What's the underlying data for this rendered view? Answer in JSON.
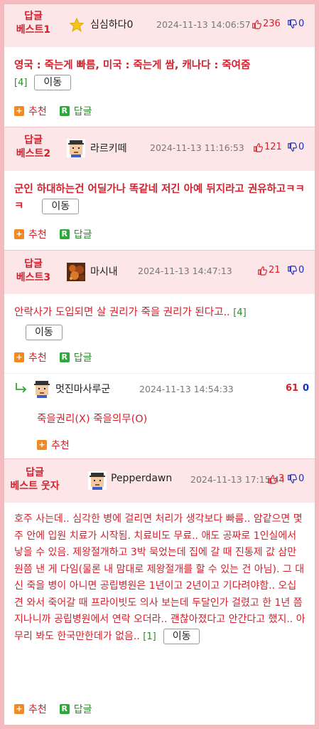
{
  "comments": [
    {
      "badge_line1": "답글",
      "badge_line2": "베스트1",
      "avatar": "star-icon",
      "nickname": "심심하다0",
      "timestamp": "2024-11-13 14:06:57",
      "upvotes": "236",
      "downvotes": "0",
      "text": "영국 : 죽는게 빠름, 미국 : 죽는게 쌈, 캐나다 : 죽여줌",
      "reply_count": "[4]",
      "move_label": "이동",
      "recommend_label": "추천",
      "reply_label": "답글"
    },
    {
      "badge_line1": "답글",
      "badge_line2": "베스트2",
      "avatar": "pixel-face-avatar",
      "nickname": "라르키떼",
      "timestamp": "2024-11-13 11:16:53",
      "upvotes": "121",
      "downvotes": "0",
      "text": "군인 하대하는건 어딜가나 똑같네 저긴 아예 뒤지라고 권유하고ㅋㅋㅋ",
      "move_label": "이동",
      "recommend_label": "추천",
      "reply_label": "답글"
    },
    {
      "badge_line1": "답글",
      "badge_line2": "베스트3",
      "avatar": "food-photo-avatar",
      "nickname": "마시내",
      "timestamp": "2024-11-13 14:47:13",
      "upvotes": "21",
      "downvotes": "0",
      "text": "안락사가 도입되면 살 권리가 죽을 권리가 된다고..",
      "reply_count": "[4]",
      "move_label": "이동",
      "recommend_label": "추천",
      "reply_label": "답글"
    }
  ],
  "reply": {
    "nickname": "멋진마사루군",
    "timestamp": "2024-11-13 14:54:33",
    "upvotes": "61",
    "downvotes": "0",
    "text": "죽을권리(X) 죽을의무(O)",
    "recommend_label": "추천"
  },
  "funny": {
    "badge_line1": "답글",
    "badge_line2": "베스트 웃자",
    "nickname": "Pepperdawn",
    "timestamp": "2024-11-13 17:15:44",
    "upvotes": "3",
    "downvotes": "0",
    "text": "호주 사는데.. 심각한 병에 걸리면 처리가 생각보다 빠름.. 암같으면 몇주 안에 입원 치료가 시작됨. 치료비도 무료.. 애도 공짜로 1인실에서 낳을 수 있음. 제왕절개하고 3박 묵었는데 집에 갈 때 진통제 값 삼만원쯤 낸 게 다임(물론 내 맘대로 제왕절개를 할 수 있는 건 아님). 그 대신 죽을 병이 아니면 공립병원은 1년이고 2년이고 기다려야함.. 오십견 와서 죽어갈 때 프라이빗도 의사 보는데 두달인가 걸렸고 한 1년 쯤 지나니까 공립병원에서 연락 오더라.. 괜찮아졌다고 안간다고 했지.. 아무리 봐도 한국만한데가 없음..",
    "reply_count": "[1]",
    "move_label": "이동",
    "recommend_label": "추천",
    "reply_label": "답글"
  },
  "colors": {
    "accent_red": "#d2222d",
    "down_blue": "#1c2dbd",
    "header_bg": "#fde6e8",
    "frame_pink": "#f5b9c0"
  }
}
